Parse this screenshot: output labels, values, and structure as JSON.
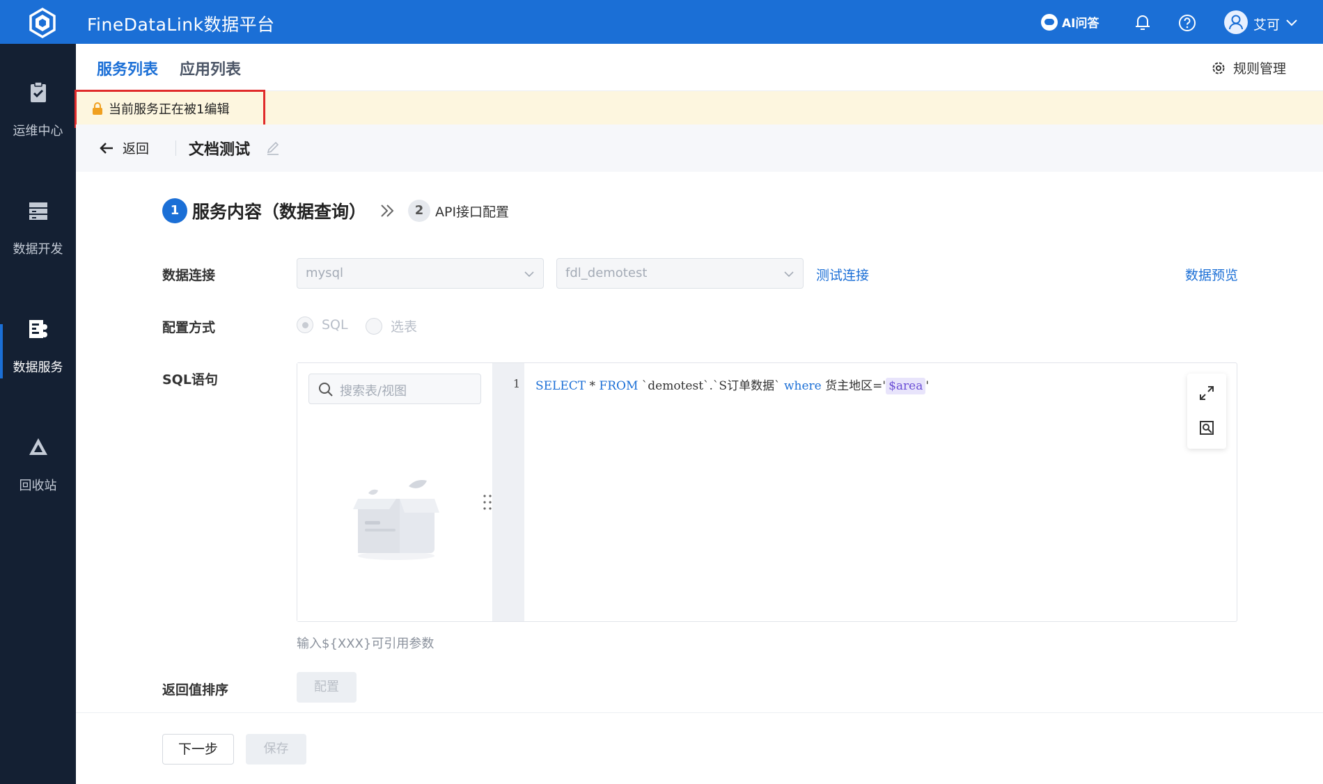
{
  "app": {
    "title": "FineDataLink数据平台"
  },
  "topbar": {
    "ai_label": "AI问答",
    "user_name": "艾可"
  },
  "sidebar": {
    "items": [
      {
        "label": "运维中心",
        "icon": "clipboard-check-icon"
      },
      {
        "label": "数据开发",
        "icon": "server-icon"
      },
      {
        "label": "数据服务",
        "icon": "data-service-icon"
      },
      {
        "label": "回收站",
        "icon": "recycle-icon"
      }
    ]
  },
  "tabs": [
    {
      "label": "服务列表",
      "active": true
    },
    {
      "label": "应用列表",
      "active": false
    }
  ],
  "rule_management": "规则管理",
  "banner": {
    "text": "当前服务正在被1编辑"
  },
  "subheader": {
    "back_label": "返回",
    "doc_title": "文档测试"
  },
  "steps": [
    {
      "number": "1",
      "label": "服务内容（数据查询）"
    },
    {
      "number": "2",
      "label": "API接口配置"
    }
  ],
  "form": {
    "connection_label": "数据连接",
    "connection_type": "mysql",
    "database": "fdl_demotest",
    "test_connection": "测试连接",
    "data_preview": "数据预览",
    "config_label": "配置方式",
    "config_options": [
      "SQL",
      "选表"
    ],
    "sql_label": "SQL语句",
    "search_placeholder": "搜索表/视图",
    "line_number": "1",
    "sql_parts": {
      "select": "SELECT",
      "star": " * ",
      "from": "FROM",
      "table": " `demotest`.`S订单数据` ",
      "where": "where",
      "cond": " 货主地区='",
      "param": "$area",
      "end": "'"
    },
    "hint": "输入${XXX}可引用参数",
    "sort_label": "返回值排序",
    "sort_button": "配置"
  },
  "footer": {
    "next": "下一步",
    "save": "保存"
  },
  "colors": {
    "brand": "#1b6fd6",
    "sidebar": "#142033",
    "banner_bg": "#fdf6df",
    "banner_border": "#e02b2b"
  }
}
